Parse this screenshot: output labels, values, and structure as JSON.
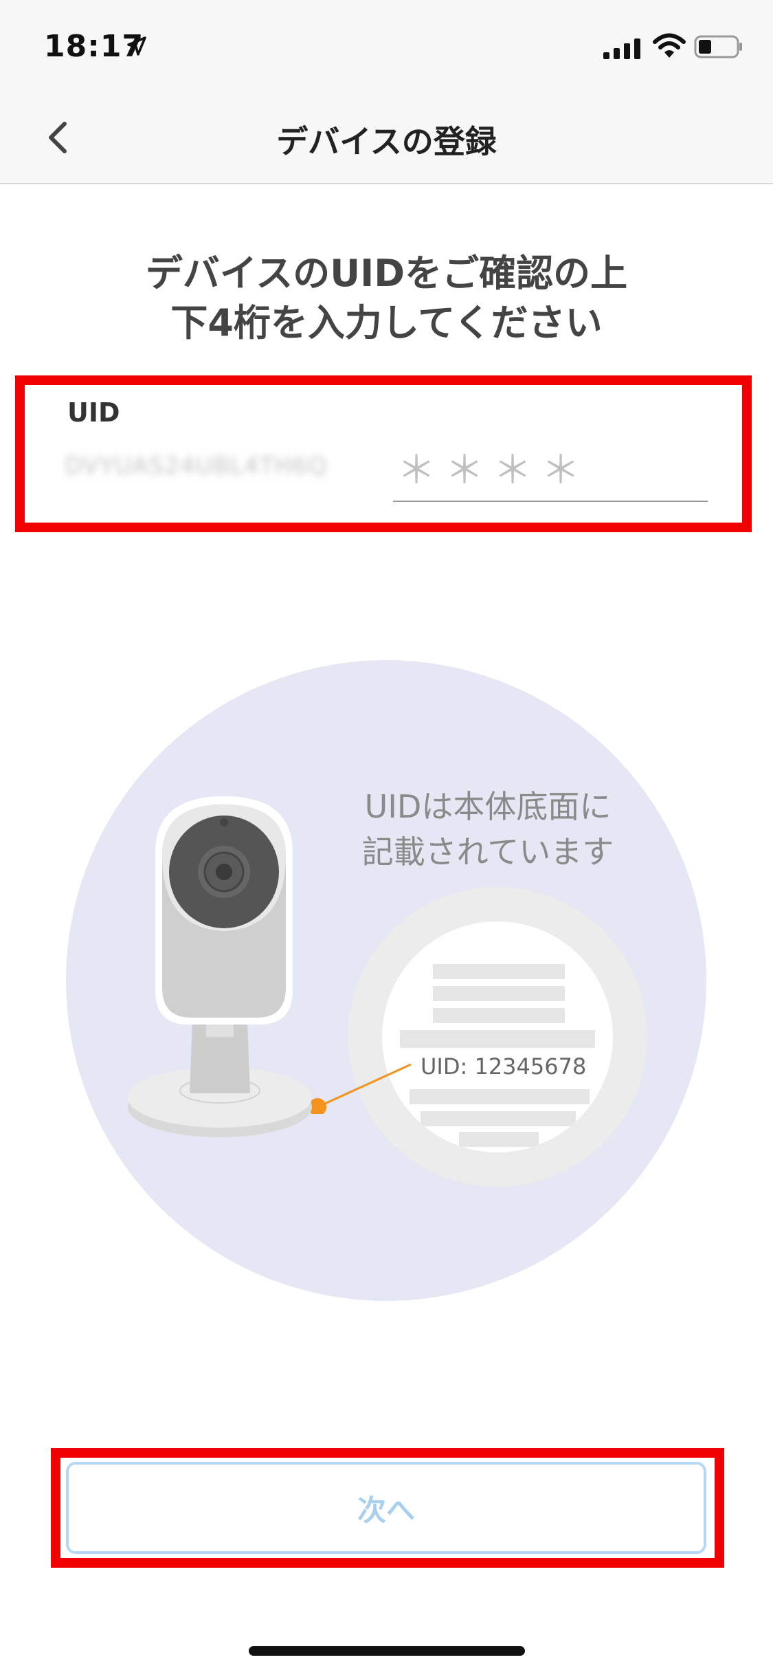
{
  "status_bar": {
    "time": "18:17",
    "location_icon": "location-arrow-icon",
    "signal_icon": "cellular-signal-icon",
    "wifi_icon": "wifi-icon",
    "battery_icon": "battery-icon"
  },
  "navbar": {
    "title": "デバイスの登録",
    "back_icon": "chevron-left-icon"
  },
  "heading": {
    "line1": "デバイスのUIDをご確認の上",
    "line2": "下4桁を入力してください"
  },
  "uid_form": {
    "label": "UID",
    "prefix": "DVYUAS24UBL4TH6Q",
    "placeholder": "＊＊＊＊"
  },
  "illustration": {
    "hint_line1": "UIDは本体底面に",
    "hint_line2": "記載されています",
    "uid_example": "UID: 12345678",
    "camera_icon": "security-camera-icon"
  },
  "next_button": {
    "label": "次へ"
  },
  "colors": {
    "annotation_red": "#f10000",
    "button_border": "#b7d8f5",
    "button_text": "#a9cff0",
    "illustration_bg": "#e5e8f4",
    "connector_orange": "#f5921e"
  }
}
